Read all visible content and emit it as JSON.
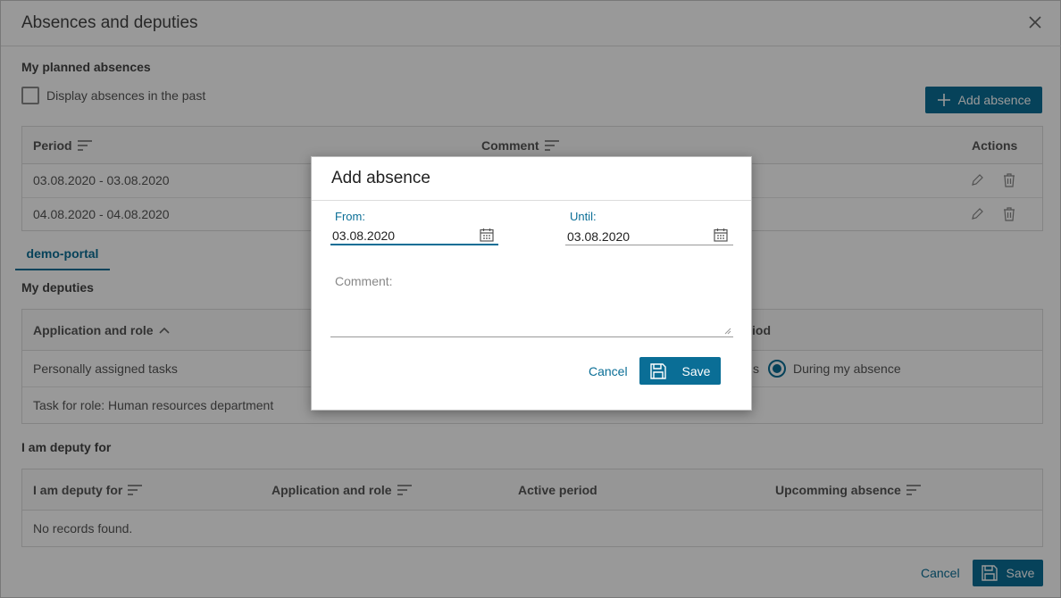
{
  "background": {
    "title": "Absences and deputies",
    "planned_absences": {
      "heading": "My planned absences",
      "show_past_label": "Display absences in the past",
      "add_button": "Add absence",
      "columns": [
        "Period",
        "Comment",
        "Actions"
      ],
      "rows": [
        {
          "period": "03.08.2020 - 03.08.2020"
        },
        {
          "period": "04.08.2020 - 04.08.2020"
        }
      ]
    },
    "tab": "demo-portal",
    "deputies": {
      "heading": "My deputies",
      "col_app_role": "Application and role",
      "col_period_suffix": "iod",
      "rows": [
        {
          "app_role": "Personally assigned tasks",
          "period_prefix": "s",
          "period_option": "During my absence"
        },
        {
          "app_role": "Task for role: Human resources department"
        }
      ]
    },
    "deputy_for": {
      "heading": "I am deputy for",
      "columns": [
        "I am deputy for",
        "Application and role",
        "Active period",
        "Upcomming absence"
      ],
      "empty": "No records found."
    },
    "footer": {
      "cancel": "Cancel",
      "save": "Save"
    }
  },
  "modal": {
    "title": "Add absence",
    "from_label": "From:",
    "from_value": "03.08.2020",
    "until_label": "Until:",
    "until_value": "03.08.2020",
    "comment_label": "Comment:",
    "cancel": "Cancel",
    "save": "Save"
  },
  "colors": {
    "accent": "#0a6e96",
    "overlay": "rgba(0,0,0,0.40)"
  },
  "icons": [
    "close-icon",
    "plus-icon",
    "sort-icon",
    "sort-up-icon",
    "edit-icon",
    "trash-icon",
    "calendar-icon",
    "save-icon"
  ]
}
